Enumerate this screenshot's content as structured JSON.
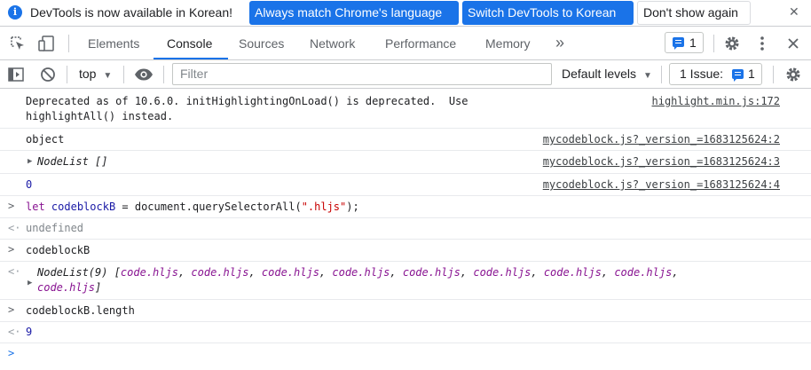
{
  "infobar": {
    "message": "DevTools is now available in Korean!",
    "btn_match": "Always match Chrome's language",
    "btn_switch": "Switch DevTools to Korean",
    "btn_dismiss": "Don't show again",
    "close": "✕"
  },
  "tabs": {
    "elements": "Elements",
    "console": "Console",
    "sources": "Sources",
    "network": "Network",
    "performance": "Performance",
    "memory": "Memory",
    "more": "»",
    "badge_count": "1"
  },
  "toolbar": {
    "context": "top",
    "filter_placeholder": "Filter",
    "levels": "Default levels",
    "issues_label": "1 Issue:",
    "issues_count": "1"
  },
  "console": {
    "row1_line1": "Deprecated as of 10.6.0. initHighlightingOnLoad() is deprecated.  Use",
    "row1_line2": "highlightAll() instead.",
    "row1_src": "highlight.min.js:172",
    "row2_text": "object",
    "row2_src": "mycodeblock.js?_version_=1683125624:2",
    "row3_text": "NodeList []",
    "row3_src": "mycodeblock.js?_version_=1683125624:3",
    "row4_text": "0",
    "row4_src": "mycodeblock.js?_version_=1683125624:4",
    "in1_kw": "let",
    "in1_var": "codeblockB",
    "in1_mid": " = document.querySelectorAll(",
    "in1_str": "\".hljs\"",
    "in1_end": ");",
    "out1": "undefined",
    "in2": "codeblockB",
    "out2_head": "NodeList(9) [",
    "out2_item": "code.hljs",
    "out2_tail": "]",
    "in3": "codeblockB.length",
    "out3": "9"
  },
  "colors": {
    "accent": "#1a73e8",
    "keyword": "#881391",
    "string": "#c80000",
    "number": "#1a1aa6"
  }
}
